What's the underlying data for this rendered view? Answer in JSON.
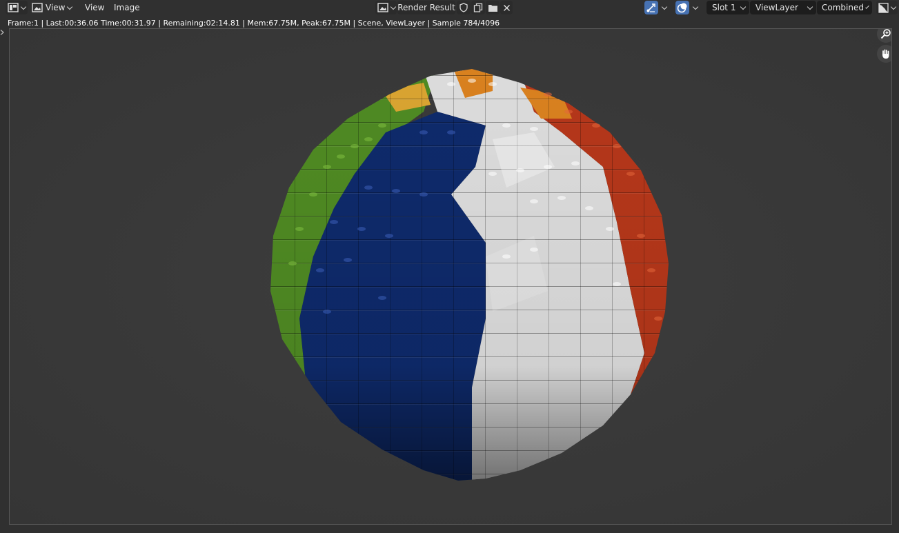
{
  "header": {
    "editor_type_icon": "image-editor-icon",
    "view_menu_dropdown": "View",
    "view_menu": "View",
    "image_menu": "Image",
    "image_browse_icon": "image-browse-icon",
    "image_name": "Render Result",
    "fake_user_icon": "shield-icon",
    "new_image_icon": "duplicate-icon",
    "open_image_icon": "folder-icon",
    "unlink_icon": "close-icon",
    "gizmo_icon": "gizmo-icon",
    "overlay_icon": "overlay-icon",
    "slot": "Slot 1",
    "view_layer": "ViewLayer",
    "pass": "Combined",
    "display_channels_icon": "color-alpha-icon"
  },
  "info": {
    "text": "Frame:1 | Last:00:36.06 Time:00:31.97 | Remaining:02:14.81 | Mem:67.75M, Peak:67.75M | Scene, ViewLayer | Sample 784/4096"
  },
  "navigation": {
    "zoom_icon": "zoom-icon",
    "pan_icon": "hand-pan-icon"
  },
  "render": {
    "subject": "lego-globe-render",
    "colors": {
      "background": "#393939",
      "green": "#4f8a23",
      "blue": "#0e2a6b",
      "white": "#dcdcdc",
      "red": "#b5371a",
      "orange": "#d9811f",
      "yellow": "#d9a431"
    }
  }
}
